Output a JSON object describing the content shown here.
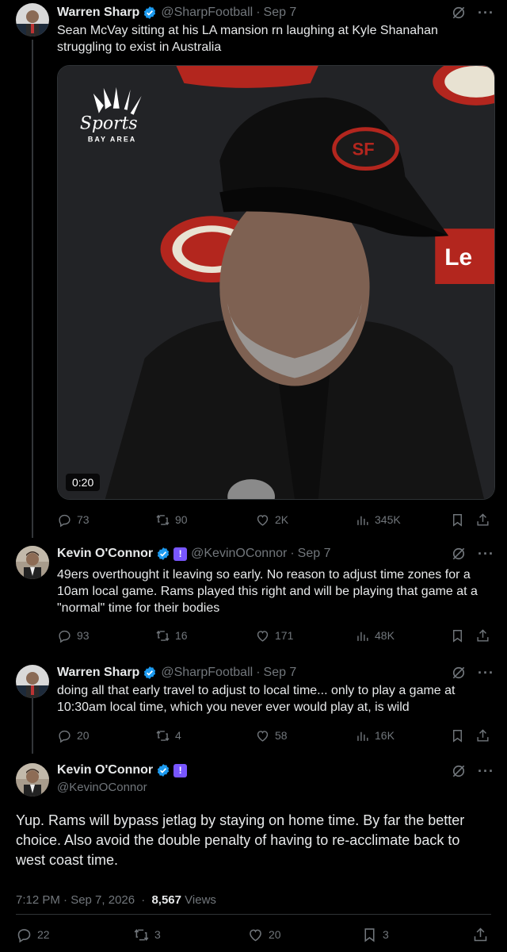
{
  "tweets": [
    {
      "name": "Warren Sharp",
      "handle": "@SharpFootball",
      "time": "Sep 7",
      "text": "Sean McVay sitting at his LA mansion rn laughing at Kyle Shanahan struggling to exist in Australia",
      "video": {
        "duration": "0:20",
        "logo_top": "Sports",
        "logo_bottom": "BAY AREA",
        "cap_logo": "SF",
        "banner_text": "Le"
      },
      "stats": {
        "replies": "73",
        "reposts": "90",
        "likes": "2K",
        "views": "345K"
      }
    },
    {
      "name": "Kevin O'Connor",
      "handle": "@KevinOConnor",
      "time": "Sep 7",
      "text": "49ers overthought it leaving so early. No reason to adjust time zones for a 10am local game. Rams played this right and will be playing that game at a \"normal\" time for their bodies",
      "stats": {
        "replies": "93",
        "reposts": "16",
        "likes": "171",
        "views": "48K"
      }
    },
    {
      "name": "Warren Sharp",
      "handle": "@SharpFootball",
      "time": "Sep 7",
      "text": "doing all that early travel to adjust to local time... only to play a game at 10:30am local time, which you never ever would play at, is wild",
      "stats": {
        "replies": "20",
        "reposts": "4",
        "likes": "58",
        "views": "16K"
      }
    }
  ],
  "main_tweet": {
    "name": "Kevin O'Connor",
    "handle": "@KevinOConnor",
    "text": "Yup. Rams will bypass jetlag by staying on home time. By far the better choice. Also avoid the double penalty of having to re-acclimate back to west coast time.",
    "timestamp": "7:12 PM · Sep 7, 2026",
    "views_count": "8,567",
    "views_label": "Views",
    "stats": {
      "replies": "22",
      "reposts": "3",
      "likes": "20",
      "bookmarks": "3"
    }
  },
  "colors": {
    "background": "#000000",
    "text": "#e7e9ea",
    "muted": "#71767b",
    "verified": "#1d9bf0",
    "affiliate_badge": "#7856ff"
  },
  "icons": [
    "reply-icon",
    "repost-icon",
    "like-icon",
    "views-icon",
    "bookmark-icon",
    "share-icon",
    "grok-icon",
    "more-icon",
    "verified-icon"
  ]
}
